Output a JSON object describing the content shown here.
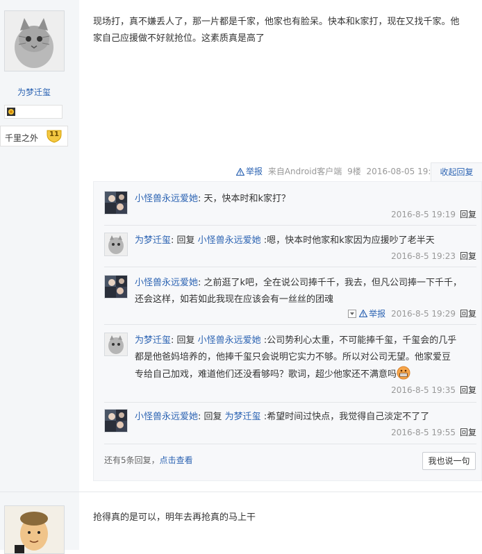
{
  "post1": {
    "author": "为梦迁玺",
    "forum_badge_name": "千里之外",
    "forum_level": "11",
    "content_lines": [
      "现场打，真不嫌丢人了，那一片都是千家，他家也有脸呆。快本和k家打，现在又找千家。他",
      "家自己应援做不好就抢位。这素质真是高了"
    ],
    "tail": {
      "report": "举报",
      "client": "来自Android客户端",
      "floor": "9楼",
      "time": "2016-08-05 19:06",
      "collapse": "收起回复"
    }
  },
  "replies": [
    {
      "user": "小怪兽永远爱她",
      "segments": [
        {
          "t": "天，快本时和k家打？",
          "c": "text"
        }
      ],
      "time": "2016-8-5 19:19",
      "reply_label": "回复"
    },
    {
      "user": "为梦迁玺",
      "segments": [
        {
          "t": "回复 ",
          "c": "text"
        },
        {
          "t": "小怪兽永远爱她",
          "c": "link"
        },
        {
          "t": " :嗯，快本时他家和k家因为应援吵了老半天",
          "c": "text"
        }
      ],
      "time": "2016-8-5 19:23",
      "reply_label": "回复"
    },
    {
      "user": "小怪兽永远爱她",
      "lines": [
        "之前逛了k吧，全在说公司捧千千，我去，但凡公司捧一下千千，",
        "还会这样，如若如此我现在应该会有一丝丝的团魂"
      ],
      "report": "举报",
      "time": "2016-8-5 19:29",
      "reply_label": "回复"
    },
    {
      "user": "为梦迁玺",
      "prefix": "回复 ",
      "target": "小怪兽永远爱她",
      "lines": [
        " :公司势利心太重，不可能捧千玺，千玺会的几乎",
        "都是他爸妈培养的，他捧千玺只会说明它实力不够。所以对公司无望。他家爱豆",
        "专给自己加戏，难道他们还没看够吗？歌词，超少他家还不满意吗"
      ],
      "time": "2016-8-5 19:35",
      "reply_label": "回复"
    },
    {
      "user": "小怪兽永远爱她",
      "segments": [
        {
          "t": "回复 ",
          "c": "text"
        },
        {
          "t": "为梦迁玺",
          "c": "link"
        },
        {
          "t": " :希望时间过快点，我觉得自己淡定不了了",
          "c": "text"
        }
      ],
      "time": "2016-8-5 19:55",
      "reply_label": "回复"
    }
  ],
  "more_replies": {
    "count_text": "还有5条回复，",
    "view_link": "点击查看"
  },
  "say_button": "我也说一句",
  "post2": {
    "content": "抢得真的是可以，明年去再抢真的马上干"
  }
}
